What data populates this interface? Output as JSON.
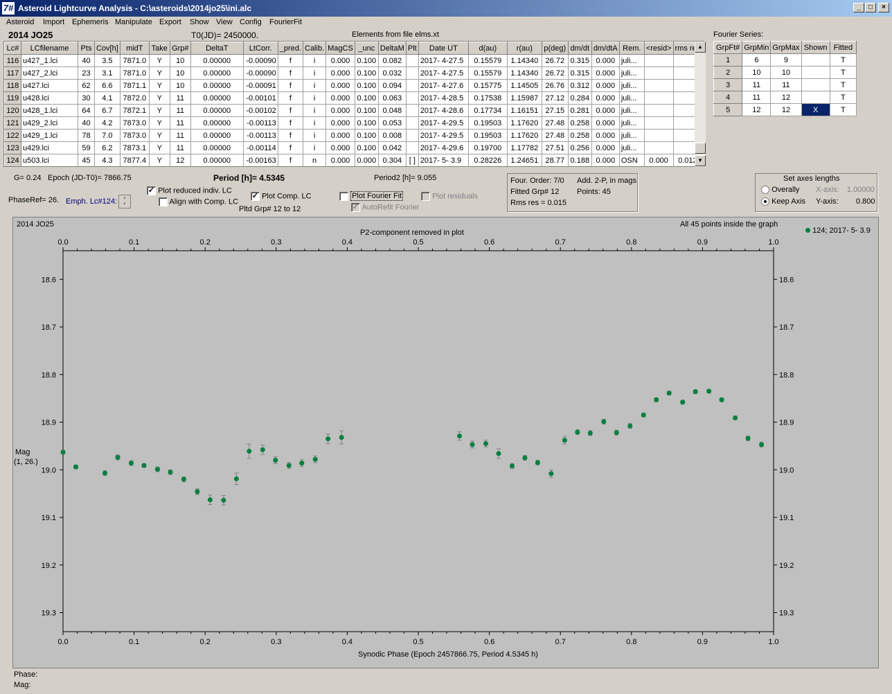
{
  "window": {
    "title": "Asteroid Lightcurve Analysis - C:\\asteroids\\2014jo25\\ini.alc",
    "app_icon": "7#"
  },
  "menu": [
    "Asteroid",
    "Import",
    "Ephemeris",
    "Manipulate",
    "Export",
    "Show",
    "View",
    "Config",
    "FourierFit"
  ],
  "header": {
    "object": "2014 JO25",
    "t0": "T0(JD)= 2450000.",
    "elements": "Elements from file elms.xt",
    "fourier_label": "Fourier Series:"
  },
  "lc_table": {
    "columns": [
      "Lc#",
      "LCfilename",
      "Pts",
      "Cov[h]",
      "midT",
      "Take",
      "Grp#",
      "DeltaT",
      "LtCorr.",
      "_pred.",
      "Calib.",
      "MagCS",
      "_unc",
      "DeltaM",
      "Plt",
      "Date UT",
      "d(au)",
      "r(au)",
      "p(deg)",
      "dm/dt",
      "dm/dtA",
      "Rem.",
      "<resid>",
      "rms res"
    ],
    "rows": [
      [
        "116",
        "u427_1.lci",
        "40",
        "3.5",
        "7871.0",
        "Y",
        "10",
        "0.00000",
        "-0.00090",
        "f",
        "i",
        "0.000",
        "0.100",
        "0.082",
        "",
        "2017- 4-27.5",
        "0.15579",
        "1.14340",
        "26.72",
        "0.315",
        "0.000",
        "juli...",
        "",
        ""
      ],
      [
        "117",
        "u427_2.lci",
        "23",
        "3.1",
        "7871.0",
        "Y",
        "10",
        "0.00000",
        "-0.00090",
        "f",
        "i",
        "0.000",
        "0.100",
        "0.032",
        "",
        "2017- 4-27.5",
        "0.15579",
        "1.14340",
        "26.72",
        "0.315",
        "0.000",
        "juli...",
        "",
        ""
      ],
      [
        "118",
        "u427.lci",
        "62",
        "6.6",
        "7871.1",
        "Y",
        "10",
        "0.00000",
        "-0.00091",
        "f",
        "i",
        "0.000",
        "0.100",
        "0.094",
        "",
        "2017- 4-27.6",
        "0.15775",
        "1.14505",
        "26.76",
        "0.312",
        "0.000",
        "juli...",
        "",
        ""
      ],
      [
        "119",
        "u428.lci",
        "30",
        "4.1",
        "7872.0",
        "Y",
        "11",
        "0.00000",
        "-0.00101",
        "f",
        "i",
        "0.000",
        "0.100",
        "0.063",
        "",
        "2017- 4-28.5",
        "0.17538",
        "1.15987",
        "27.12",
        "0.284",
        "0.000",
        "juli...",
        "",
        ""
      ],
      [
        "120",
        "u428_1.lci",
        "64",
        "6.7",
        "7872.1",
        "Y",
        "11",
        "0.00000",
        "-0.00102",
        "f",
        "i",
        "0.000",
        "0.100",
        "0.048",
        "",
        "2017- 4-28.6",
        "0.17734",
        "1.16151",
        "27.15",
        "0.281",
        "0.000",
        "juli...",
        "",
        ""
      ],
      [
        "121",
        "u429_2.lci",
        "40",
        "4.2",
        "7873.0",
        "Y",
        "11",
        "0.00000",
        "-0.00113",
        "f",
        "i",
        "0.000",
        "0.100",
        "0.053",
        "",
        "2017- 4-29.5",
        "0.19503",
        "1.17620",
        "27.48",
        "0.258",
        "0.000",
        "juli...",
        "",
        ""
      ],
      [
        "122",
        "u429_1.lci",
        "78",
        "7.0",
        "7873.0",
        "Y",
        "11",
        "0.00000",
        "-0.00113",
        "f",
        "i",
        "0.000",
        "0.100",
        "0.008",
        "",
        "2017- 4-29.5",
        "0.19503",
        "1.17620",
        "27.48",
        "0.258",
        "0.000",
        "juli...",
        "",
        ""
      ],
      [
        "123",
        "u429.lci",
        "59",
        "6.2",
        "7873.1",
        "Y",
        "11",
        "0.00000",
        "-0.00114",
        "f",
        "i",
        "0.000",
        "0.100",
        "0.042",
        "",
        "2017- 4-29.6",
        "0.19700",
        "1.17782",
        "27.51",
        "0.256",
        "0.000",
        "juli...",
        "",
        ""
      ],
      [
        "124",
        "u503.lci",
        "45",
        "4.3",
        "7877.4",
        "Y",
        "12",
        "0.00000",
        "-0.00163",
        "f",
        "n",
        "0.000",
        "0.000",
        "0.304",
        "[ ]",
        "2017- 5- 3.9",
        "0.28226",
        "1.24651",
        "28.77",
        "0.188",
        "0.000",
        "OSN",
        "0.000",
        "0.012"
      ]
    ]
  },
  "fourier_table": {
    "columns": [
      "GrpFt#",
      "GrpMin",
      "GrpMax",
      "Shown",
      "Fitted"
    ],
    "rows": [
      [
        "1",
        "6",
        "9",
        "",
        "T"
      ],
      [
        "2",
        "10",
        "10",
        "",
        "T"
      ],
      [
        "3",
        "11",
        "11",
        "",
        "T"
      ],
      [
        "4",
        "11",
        "12",
        "",
        "T"
      ],
      [
        "5",
        "12",
        "12",
        "X",
        "T"
      ]
    ]
  },
  "params": {
    "g": "G= 0.24",
    "epoch": "Epoch (JD-T0)= 7866.75",
    "period": "Period [h]= 4.5345",
    "period2": "Period2 [h]= 9.055",
    "phaseref": "PhaseRef= 26.",
    "emph": "Emph. Lc#124:",
    "plot_reduced": "Plot reduced indiv. LC",
    "align": "Align with Comp. LC",
    "plot_comp": "Plot Comp. LC",
    "pltd_grp": "Pltd Grp#  12 to   12",
    "plot_fourier": "Plot Fourier Fit",
    "autorefit": "AutoRefit Fourier",
    "plot_resid": "Plot residuals"
  },
  "fourier_info": {
    "order": "Four. Order:  7/0",
    "add": "Add. 2-P, in mags",
    "fitted": "Fitted Grp# 12",
    "points": "Points: 45",
    "rms": "Rms res      = 0.015"
  },
  "axes_box": {
    "title": "Set axes lengths",
    "overally": "Overally",
    "keep": "Keep Axis",
    "xaxis_label": "X-axis:",
    "xaxis_val": "1.00000",
    "yaxis_label": "Y-axis:",
    "yaxis_val": "0.800"
  },
  "status": {
    "phase": "Phase:",
    "mag": "Mag:"
  },
  "chart_data": {
    "type": "scatter",
    "title": "2014 JO25",
    "info": "All 45 points inside the graph",
    "top_label": "P2-component removed in plot",
    "xlabel": "Synodic Phase (Epoch 2457866.75, Period 4.5345 h)",
    "ylabel": "Mag",
    "ylabel2": "(1, 26.)",
    "xlim": [
      0.0,
      1.0
    ],
    "ylim": [
      19.34,
      18.54
    ],
    "inverted_y": true,
    "xticks": [
      "0.0",
      "0.1",
      "0.2",
      "0.3",
      "0.4",
      "0.5",
      "0.6",
      "0.7",
      "0.8",
      "0.9",
      "1.0"
    ],
    "yticks": [
      "18.6",
      "18.7",
      "18.8",
      "18.9",
      "19.0",
      "19.1",
      "19.2",
      "19.3"
    ],
    "legend": "124; 2017- 5- 3.9",
    "marker_color": "#007f3f",
    "points": [
      [
        0.0,
        18.963,
        0.004
      ],
      [
        0.018,
        18.994,
        0.004
      ],
      [
        0.059,
        19.007,
        0.005
      ],
      [
        0.077,
        18.974,
        0.005
      ],
      [
        0.096,
        18.986,
        0.005
      ],
      [
        0.114,
        18.991,
        0.004
      ],
      [
        0.133,
        18.999,
        0.005
      ],
      [
        0.151,
        19.005,
        0.005
      ],
      [
        0.17,
        19.02,
        0.005
      ],
      [
        0.189,
        19.046,
        0.006
      ],
      [
        0.207,
        19.063,
        0.01
      ],
      [
        0.226,
        19.064,
        0.01
      ],
      [
        0.244,
        19.019,
        0.012
      ],
      [
        0.262,
        18.961,
        0.015
      ],
      [
        0.281,
        18.958,
        0.01
      ],
      [
        0.299,
        18.98,
        0.007
      ],
      [
        0.318,
        18.991,
        0.006
      ],
      [
        0.336,
        18.986,
        0.007
      ],
      [
        0.355,
        18.978,
        0.007
      ],
      [
        0.373,
        18.935,
        0.01
      ],
      [
        0.392,
        18.932,
        0.014
      ],
      [
        0.558,
        18.929,
        0.009
      ],
      [
        0.576,
        18.947,
        0.007
      ],
      [
        0.595,
        18.945,
        0.007
      ],
      [
        0.613,
        18.966,
        0.01
      ],
      [
        0.632,
        18.992,
        0.005
      ],
      [
        0.65,
        18.975,
        0.005
      ],
      [
        0.668,
        18.985,
        0.005
      ],
      [
        0.687,
        19.008,
        0.008
      ],
      [
        0.706,
        18.938,
        0.008
      ],
      [
        0.724,
        18.921,
        0.005
      ],
      [
        0.742,
        18.923,
        0.005
      ],
      [
        0.761,
        18.899,
        0.005
      ],
      [
        0.779,
        18.922,
        0.005
      ],
      [
        0.798,
        18.908,
        0.005
      ],
      [
        0.817,
        18.885,
        0.004
      ],
      [
        0.835,
        18.853,
        0.004
      ],
      [
        0.853,
        18.839,
        0.004
      ],
      [
        0.872,
        18.858,
        0.004
      ],
      [
        0.89,
        18.836,
        0.004
      ],
      [
        0.909,
        18.835,
        0.004
      ],
      [
        0.927,
        18.853,
        0.004
      ],
      [
        0.946,
        18.891,
        0.004
      ],
      [
        0.964,
        18.934,
        0.005
      ],
      [
        0.983,
        18.947,
        0.005
      ]
    ]
  }
}
